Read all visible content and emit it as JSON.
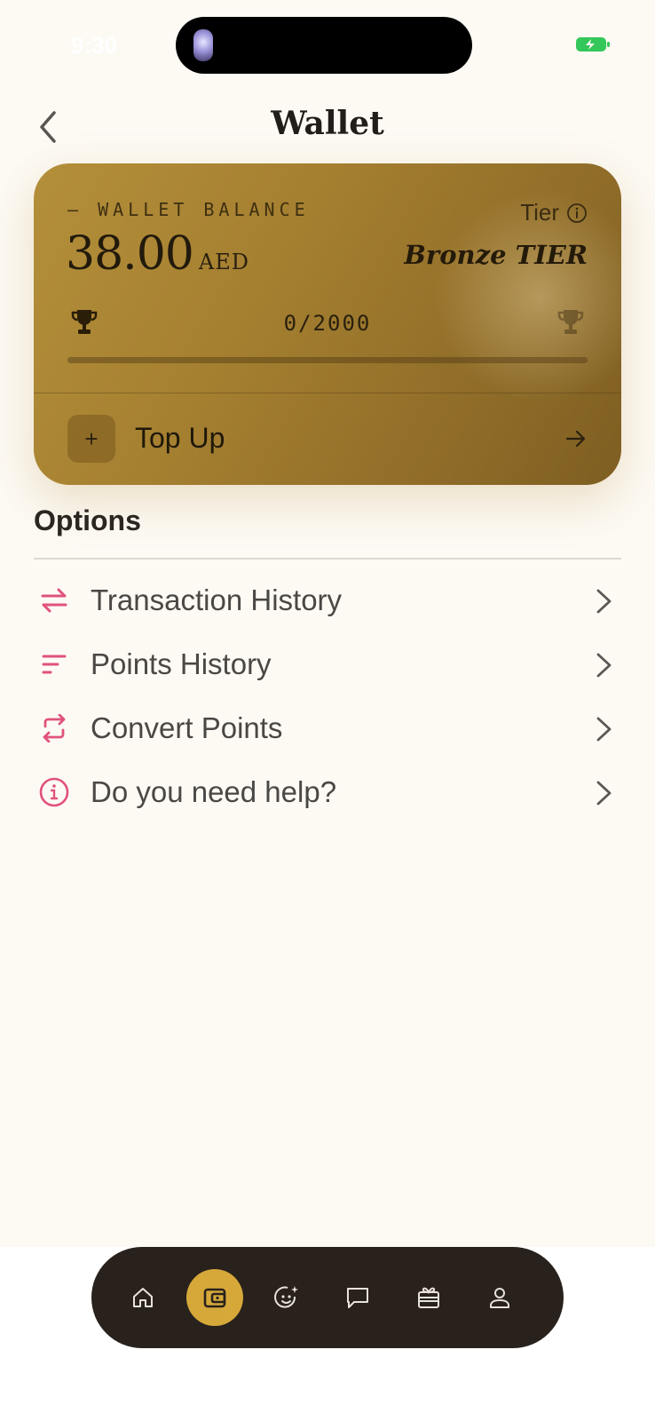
{
  "status_bar": {
    "time": "9:30"
  },
  "header": {
    "title": "Wallet",
    "back_icon": "chevron-left-icon"
  },
  "wallet_card": {
    "balance_label": "— WALLET BALANCE",
    "balance_amount": "38.00",
    "currency": "AED",
    "tier_label": "Tier",
    "tier_value": "Bronze TIER",
    "progress_text": "0/2000",
    "progress_fraction": 0.0,
    "topup_plus": "+",
    "topup_label": "Top Up"
  },
  "options": {
    "title": "Options",
    "items": [
      {
        "label": "Transaction History",
        "icon": "arrows-swap-icon"
      },
      {
        "label": "Points History",
        "icon": "sort-lines-icon"
      },
      {
        "label": "Convert Points",
        "icon": "repeat-icon"
      },
      {
        "label": "Do you need help?",
        "icon": "info-circle-icon"
      }
    ]
  },
  "bottom_nav": {
    "items": [
      {
        "name": "home",
        "icon": "home-icon",
        "active": false
      },
      {
        "name": "wallet",
        "icon": "wallet-icon",
        "active": true
      },
      {
        "name": "ai",
        "icon": "sparkle-face-icon",
        "active": false
      },
      {
        "name": "chat",
        "icon": "chat-icon",
        "active": false
      },
      {
        "name": "gifts",
        "icon": "gift-card-icon",
        "active": false
      },
      {
        "name": "profile",
        "icon": "user-icon",
        "active": false
      }
    ]
  },
  "colors": {
    "background": "#fdfaf4",
    "card_gold": "#a47f30",
    "accent_pink": "#e0537a",
    "nav_dark": "#28211c",
    "nav_active": "#d6a83a"
  }
}
